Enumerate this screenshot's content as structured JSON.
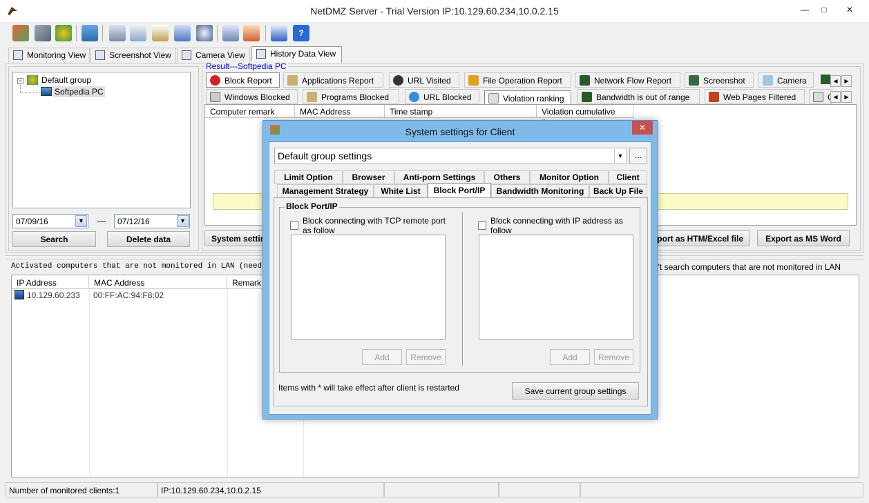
{
  "window": {
    "title": "NetDMZ Server - Trial Version IP:10.129.60.234,10.0.2.15",
    "min": "—",
    "max": "□",
    "close": "✕"
  },
  "toolbar": {
    "icons": [
      "computers-icon",
      "settings-icon",
      "users-icon",
      "key-icon",
      "monitor-icon",
      "mail-icon",
      "search-doc-icon",
      "network-icon",
      "disk-icon",
      "report-icon",
      "user-card-icon",
      "cart-icon",
      "help-icon"
    ]
  },
  "main_tabs": [
    "Monitoring View",
    "Screenshot View",
    "Camera View",
    "History Data View"
  ],
  "tree": {
    "group": "Default group",
    "pc": "Softpedia PC"
  },
  "dates": {
    "from": "07/09/16",
    "dash": "—",
    "to": "07/12/16"
  },
  "buttons": {
    "search": "Search",
    "delete": "Delete data",
    "system_settings": "System settin",
    "export_htm": "port as HTM/Excel file",
    "export_word": "Export as MS Word"
  },
  "result": {
    "label": "Result---Softpedia PC"
  },
  "report_tabs_row1": [
    "Block Report",
    "Applications Report",
    "URL Visited",
    "File Operation Report",
    "Network Flow Report",
    "Screenshot",
    "Camera"
  ],
  "report_tabs_row2": [
    "Windows Blocked",
    "Programs Blocked",
    "URL Blocked",
    "Violation ranking",
    "Bandwidth is out of range",
    "Web Pages Filtered",
    "C"
  ],
  "result_columns": [
    "Computer remark",
    "MAC Address",
    "Time stamp",
    "Violation cumulative n..."
  ],
  "lan": {
    "left_text": "Activated computers that are not monitored in LAN (need to in",
    "right_text": "n't search computers that are not monitored in LAN",
    "columns": [
      "IP Address",
      "MAC Address",
      "Remark"
    ],
    "rows": [
      {
        "ip": "10.129.60.233",
        "mac": "00:FF:AC:94:F8:02"
      }
    ]
  },
  "status": {
    "clients": "Number of monitored clients:1",
    "ip": "IP:10.129.60.234,10.0.2.15"
  },
  "dialog": {
    "title": "System settings for Client",
    "close": "✕",
    "group_select": "Default group settings",
    "more": "...",
    "tabs_row1": [
      "Limit Option",
      "Browser",
      "Anti-porn Settings",
      "Others",
      "Monitor Option",
      "Client"
    ],
    "tabs_row2": [
      "Management Strategy",
      "White List",
      "Block Port/IP",
      "Bandwidth Monitoring",
      "Back Up File"
    ],
    "group_title": "Block Port/IP",
    "left_check": "Block connecting with TCP remote port as follow",
    "right_check": "Block connecting with IP address as follow",
    "add": "Add",
    "remove": "Remove",
    "note": "Items with * will take effect after client is restarted",
    "save": "Save current group settings"
  },
  "colors": {
    "dialog_frame": "#7fbbea",
    "close_red": "#c75050",
    "highlight_yellow": "#fbfbc8",
    "link_blue": "#0000cc"
  }
}
